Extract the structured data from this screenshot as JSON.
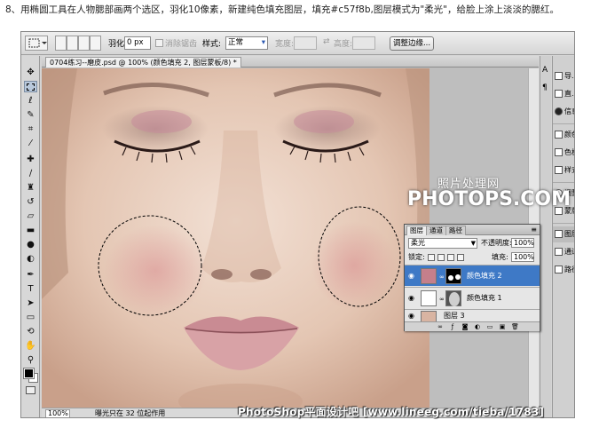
{
  "caption": "8、用椭圆工具在人物腮部画两个选区，羽化10像素，新建纯色填充图层，填充#c57f8b,图层模式为\"柔光\"，给脸上涂上淡淡的腮红。",
  "options_bar": {
    "feather_label": "羽化:",
    "feather_value": "0 px",
    "antialias_label": "消除锯齿",
    "style_label": "样式:",
    "style_value": "正常",
    "width_label": "宽度:",
    "height_label": "高度:",
    "refine_edge_button": "调整边缘..."
  },
  "document": {
    "tab_title": "0704练习--磨皮.psd @ 100% (颜色填充 2, 图层蒙板/8) *",
    "zoom": "100%",
    "status": "曝光只在 32 位起作用"
  },
  "watermark": {
    "line1": "照片处理网",
    "line2": "PHOTOPS.COM",
    "footer": "PhotoShop平面设计吧 [www.lineeg.com/tieba/1783]"
  },
  "dock_panels": [
    {
      "label": "导...",
      "icon": "navigator-icon"
    },
    {
      "label": "直...",
      "icon": "histogram-icon"
    },
    {
      "label": "信息",
      "icon": "info-icon"
    },
    {
      "label": "颜色",
      "icon": "color-icon"
    },
    {
      "label": "色板",
      "icon": "swatches-icon"
    },
    {
      "label": "样式",
      "icon": "styles-icon"
    },
    {
      "label": "调整",
      "icon": "adjustments-icon"
    },
    {
      "label": "蒙版",
      "icon": "masks-icon"
    },
    {
      "label": "图层",
      "icon": "layers-icon"
    },
    {
      "label": "通道",
      "icon": "channels-icon"
    },
    {
      "label": "路径",
      "icon": "paths-icon"
    }
  ],
  "layers_panel": {
    "tabs": [
      "图层",
      "通道",
      "路径"
    ],
    "blend_mode": "柔光",
    "opacity_label": "不透明度:",
    "opacity_value": "100%",
    "lock_label": "锁定:",
    "fill_label": "填充:",
    "fill_value": "100%",
    "layers": [
      {
        "name": "颜色填充 2",
        "selected": true,
        "thumb_color": "#c57f8b"
      },
      {
        "name": "颜色填充 1",
        "selected": false,
        "thumb_color": "#ffffff"
      },
      {
        "name": "图层 3",
        "selected": false,
        "thumb_color": "#d8b4a2"
      }
    ]
  },
  "colors": {
    "fill_color": "#c57f8b",
    "selection_bg": "#3e79c6"
  }
}
